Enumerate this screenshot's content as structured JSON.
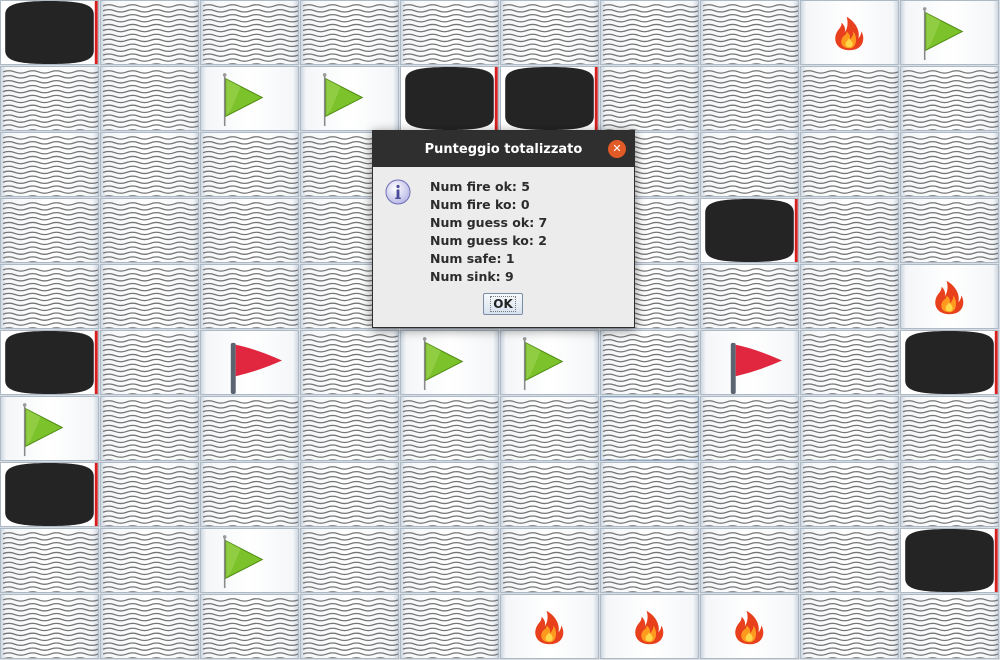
{
  "board": {
    "rows": [
      [
        "sink",
        "water",
        "water",
        "water",
        "water",
        "water",
        "water",
        "water",
        "fire",
        "flag-green"
      ],
      [
        "water",
        "water",
        "flag-green",
        "flag-green",
        "sink",
        "sink",
        "water",
        "water",
        "water",
        "water"
      ],
      [
        "water",
        "water",
        "water",
        "water",
        "water",
        "water",
        "water",
        "water",
        "water",
        "water"
      ],
      [
        "water",
        "water",
        "water",
        "water",
        "water",
        "water",
        "water",
        "sink",
        "water",
        "water"
      ],
      [
        "water",
        "water",
        "water",
        "water",
        "water",
        "water",
        "water",
        "water",
        "water",
        "fire"
      ],
      [
        "sink",
        "water",
        "flag-red",
        "water",
        "flag-green",
        "flag-green",
        "water",
        "flag-red",
        "water",
        "sink"
      ],
      [
        "flag-green",
        "water",
        "water",
        "water",
        "water",
        "water",
        "selected",
        "water",
        "water",
        "water"
      ],
      [
        "sink",
        "water",
        "water",
        "water",
        "water",
        "water",
        "water",
        "water",
        "water",
        "water"
      ],
      [
        "water",
        "water",
        "flag-green",
        "water",
        "water",
        "water",
        "water",
        "water",
        "water",
        "sink"
      ],
      [
        "water",
        "water",
        "water",
        "water",
        "water",
        "fire",
        "fire",
        "fire",
        "water",
        "water"
      ]
    ]
  },
  "dialog": {
    "title": "Punteggio totalizzato",
    "close_icon": "close-icon",
    "icon": "info-icon",
    "lines": [
      "Num fire ok: 5",
      "Num fire ko: 0",
      "Num guess ok: 7",
      "Num guess ko: 2",
      "Num safe: 1",
      "Num sink: 9"
    ],
    "ok_label": "OK"
  },
  "colors": {
    "flag_green": "#7cc22a",
    "flag_red": "#e0273f",
    "sink_black": "#242424",
    "sink_edge": "#d62020",
    "titlebar": "#2f2f2f",
    "close_button": "#e25a25"
  }
}
